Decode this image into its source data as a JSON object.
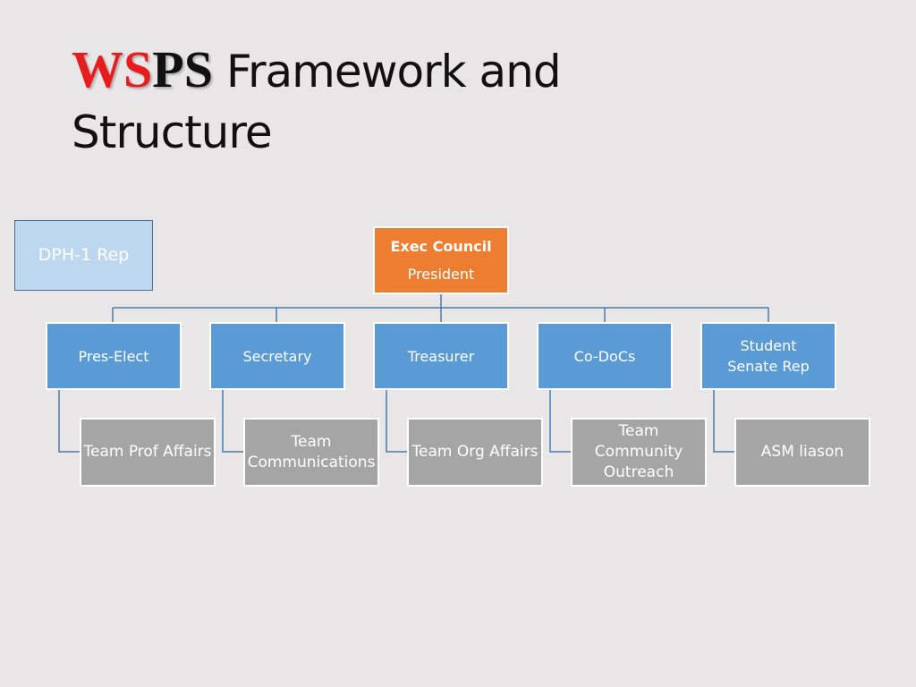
{
  "slide": {
    "title": {
      "logo_red": "WS",
      "logo_black": "PS",
      "text_line1": " Framework and",
      "text_line2": "Structure"
    },
    "side_box": {
      "label": "DPH-1 Rep"
    },
    "org_chart": {
      "root": {
        "title": "Exec Council",
        "subtitle": "President"
      },
      "officers": [
        {
          "label": "Pres-Elect",
          "team": "Team Prof Affairs"
        },
        {
          "label": "Secretary",
          "team": "Team Communications"
        },
        {
          "label": "Treasurer",
          "team": "Team Org Affairs"
        },
        {
          "label": "Co-DoCs",
          "team": "Team Community Outreach"
        },
        {
          "label": "Student Senate Rep",
          "team": "ASM liason"
        }
      ]
    },
    "colors": {
      "root": "#ed7d31",
      "officer": "#5b9bd5",
      "team": "#a5a5a5",
      "side": "#bdd7ee",
      "connector": "#4a7ab0",
      "logo_red": "#e81c1c"
    }
  }
}
